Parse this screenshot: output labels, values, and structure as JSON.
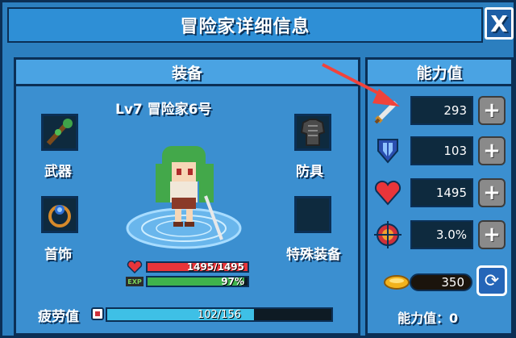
{
  "window": {
    "title": "冒险家详细信息",
    "close_label": "X"
  },
  "equipment": {
    "header": "装备",
    "character": {
      "level_name": "Lv7  冒险家6号"
    },
    "slots": [
      {
        "label": "武器"
      },
      {
        "label": "防具"
      },
      {
        "label": "首饰"
      },
      {
        "label": "特殊装备"
      }
    ],
    "hp": {
      "text": "1495/1495",
      "fraction": 1.0,
      "color": "#e8353a"
    },
    "exp": {
      "text": "97%",
      "fraction": 0.97,
      "color": "#3fb34c"
    },
    "fatigue": {
      "label": "疲劳值",
      "text": "102/156",
      "fraction": 0.654,
      "color": "#3ec0e6"
    }
  },
  "abilities": {
    "header": "能力值",
    "stats": [
      {
        "icon": "sword-icon",
        "value": "293"
      },
      {
        "icon": "shield-icon",
        "value": "103"
      },
      {
        "icon": "heart-icon",
        "value": "1495"
      },
      {
        "icon": "crosshair-icon",
        "value": "3.0%"
      }
    ],
    "plus_label": "+",
    "gold": "350",
    "points_label": "能力值：0"
  }
}
